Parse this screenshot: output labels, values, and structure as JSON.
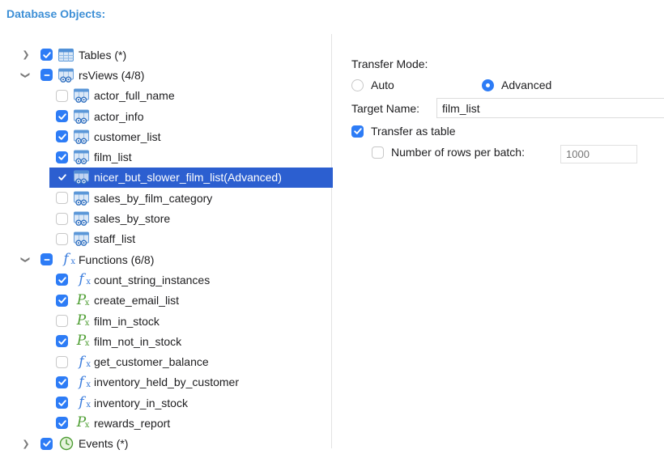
{
  "header": {
    "title": "Database Objects:"
  },
  "tree": {
    "tables": {
      "label": "Tables (*)"
    },
    "views": {
      "label": "rsViews (4/8)",
      "items": [
        {
          "label": "actor_full_name",
          "checked": false
        },
        {
          "label": "actor_info",
          "checked": true
        },
        {
          "label": "customer_list",
          "checked": true
        },
        {
          "label": "film_list",
          "checked": true
        },
        {
          "label": "nicer_but_slower_film_list(Advanced)",
          "checked": true,
          "selected": true
        },
        {
          "label": "sales_by_film_category",
          "checked": false
        },
        {
          "label": "sales_by_store",
          "checked": false
        },
        {
          "label": "staff_list",
          "checked": false
        }
      ]
    },
    "functions": {
      "label": "Functions (6/8)",
      "items": [
        {
          "label": "count_string_instances",
          "checked": true,
          "icon": "function-icon"
        },
        {
          "label": "create_email_list",
          "checked": true,
          "icon": "procedure-icon"
        },
        {
          "label": "film_in_stock",
          "checked": false,
          "icon": "procedure-icon"
        },
        {
          "label": "film_not_in_stock",
          "checked": true,
          "icon": "procedure-icon"
        },
        {
          "label": "get_customer_balance",
          "checked": false,
          "icon": "function-icon"
        },
        {
          "label": "inventory_held_by_customer",
          "checked": true,
          "icon": "function-icon"
        },
        {
          "label": "inventory_in_stock",
          "checked": true,
          "icon": "function-icon"
        },
        {
          "label": "rewards_report",
          "checked": true,
          "icon": "procedure-icon"
        }
      ]
    },
    "events": {
      "label": "Events (*)"
    }
  },
  "options": {
    "transfer_mode_label": "Transfer Mode:",
    "mode_auto": "Auto",
    "mode_advanced": "Advanced",
    "selected_mode": "Advanced",
    "target_name_label": "Target Name:",
    "target_name_value": "film_list",
    "transfer_as_table_label": "Transfer as table",
    "transfer_as_table_checked": true,
    "rows_per_batch_label": "Number of rows per batch:",
    "rows_per_batch_placeholder": "1000",
    "rows_per_batch_checked": false
  },
  "colors": {
    "accent": "#2d7cf6",
    "selection": "#2c5fd0",
    "title": "#3d8fd6",
    "function_icon": "#3b7ddd",
    "procedure_icon": "#4d9e32"
  }
}
